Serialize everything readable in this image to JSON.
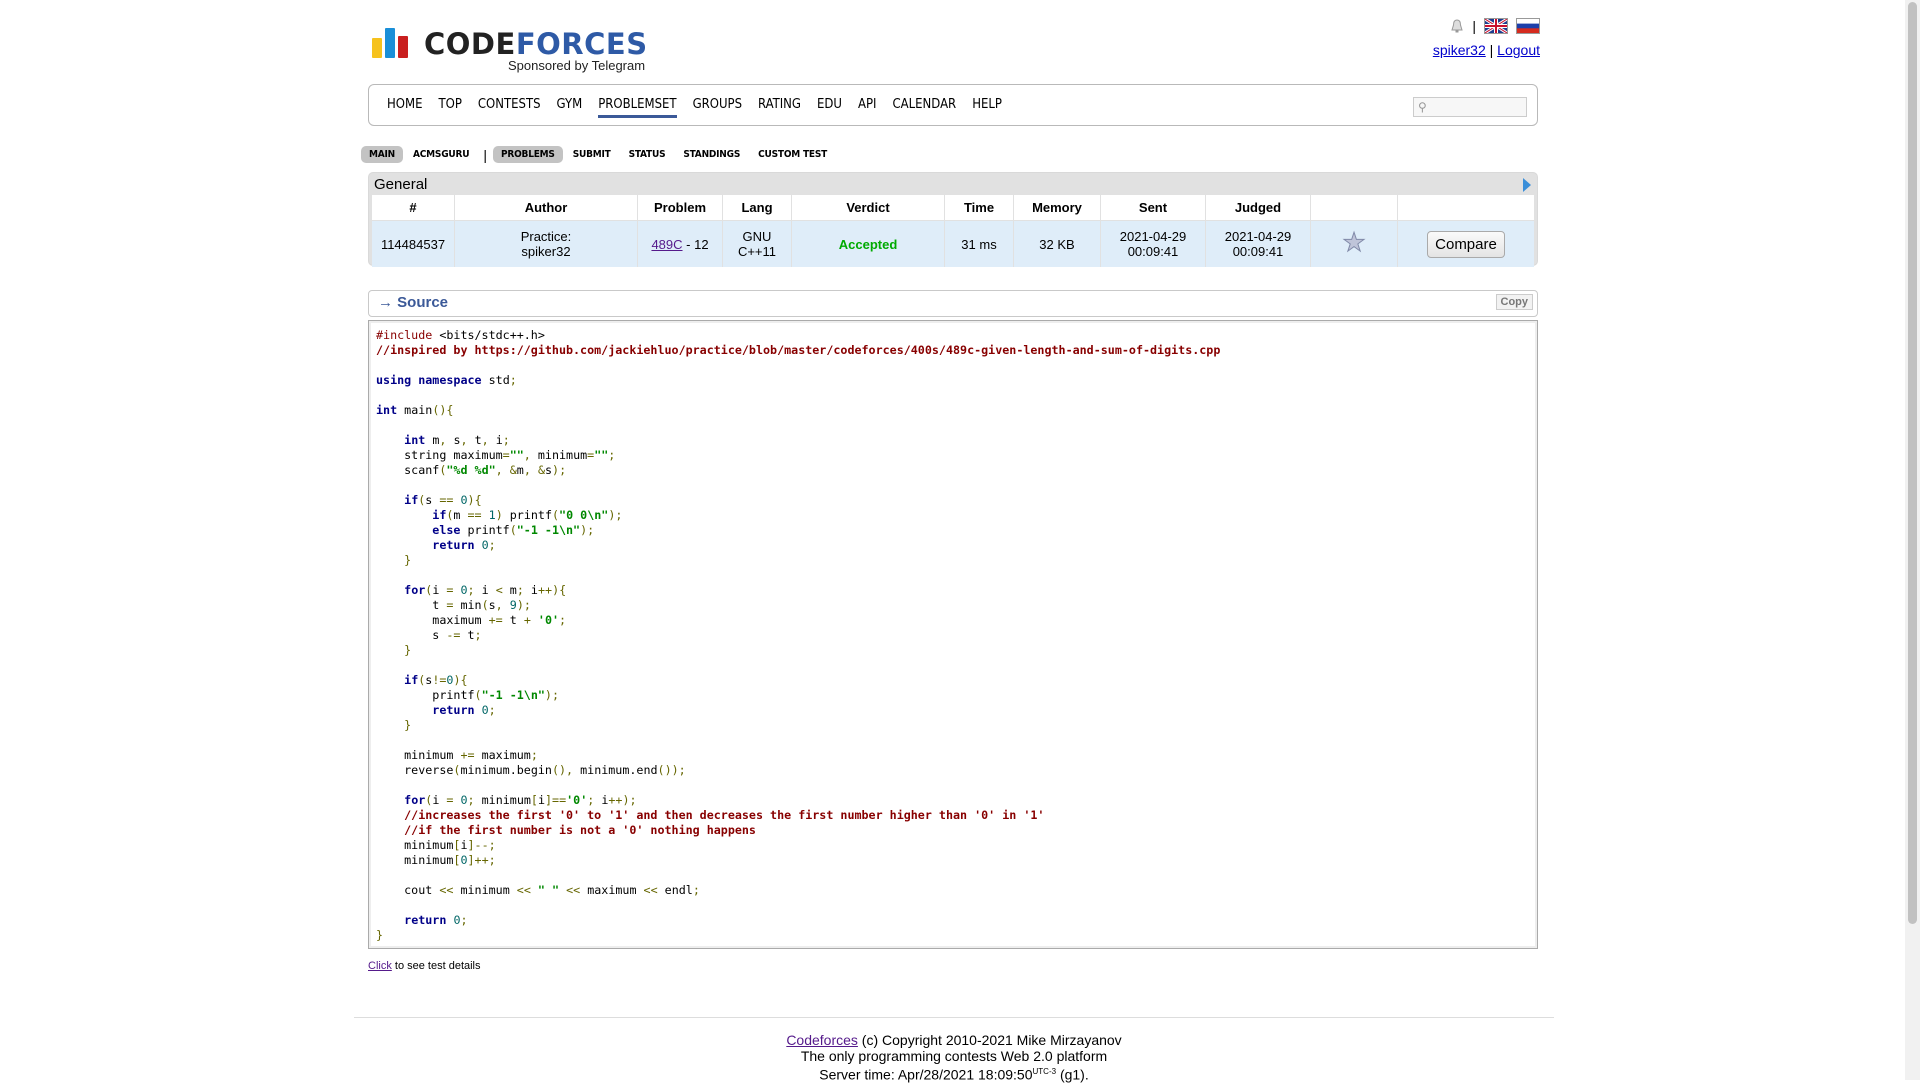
{
  "header": {
    "logo_code": "CODE",
    "logo_forces": "FORCES",
    "logo_sub": "Sponsored by Telegram",
    "user": "spiker32",
    "logout": "Logout",
    "separator": "|"
  },
  "menu": {
    "items": [
      "HOME",
      "TOP",
      "CONTESTS",
      "GYM",
      "PROBLEMSET",
      "GROUPS",
      "RATING",
      "EDU",
      "API",
      "CALENDAR",
      "HELP"
    ],
    "active": "PROBLEMSET",
    "search_placeholder": ""
  },
  "subnav": {
    "items": [
      "MAIN",
      "ACMSGURU",
      "PROBLEMS",
      "SUBMIT",
      "STATUS",
      "STANDINGS",
      "CUSTOM TEST"
    ]
  },
  "general": {
    "caption": "General",
    "columns": [
      "#",
      "Author",
      "Problem",
      "Lang",
      "Verdict",
      "Time",
      "Memory",
      "Sent",
      "Judged",
      "",
      ""
    ],
    "row": {
      "id": "114484537",
      "author_line1": "Practice:",
      "author_line2": "spiker32",
      "problem_link": "489C",
      "problem_suffix": " - 12",
      "lang_line1": "GNU",
      "lang_line2": "C++11",
      "verdict": "Accepted",
      "time": "31 ms",
      "memory": "32 KB",
      "sent_date": "2021-04-29",
      "sent_time": "00:09:41",
      "judged_date": "2021-04-29",
      "judged_time": "00:09:41",
      "compare": "Compare"
    }
  },
  "source": {
    "title": "→ Source",
    "copy": "Copy",
    "code": "#include <bits/stdc++.h>\n//inspired by https://github.com/jackiehluo/practice/blob/master/codeforces/400s/489c-given-length-and-sum-of-digits.cpp\n\nusing namespace std;\n\nint main(){\n\n    int m, s, t, i;\n    string maximum=\"\", minimum=\"\";\n    scanf(\"%d %d\", &m, &s);\n\n    if(s == 0){\n        if(m == 1) printf(\"0 0\\n\");\n        else printf(\"-1 -1\\n\");\n        return 0;\n    }\n\n    for(i = 0; i < m; i++){\n        t = min(s, 9);\n        maximum += t + '0';\n        s -= t;\n    }\n\n    if(s!=0){\n        printf(\"-1 -1\\n\");\n        return 0;\n    }\n\n    minimum += maximum;\n    reverse(minimum.begin(), minimum.end());\n\n    for(i = 0; minimum[i]=='0'; i++);\n    //increases the first '0' to '1' and then decreases the first number higher than '0' in '1'\n    //if the first number is not a '0' nothing happens\n    minimum[i]--;\n    minimum[0]++;\n\n    cout << minimum << \" \" << maximum << endl;\n\n    return 0;\n}"
  },
  "click": {
    "link": "Click",
    "rest": " to see test details"
  },
  "footer": {
    "link": "Codeforces",
    "copyright": " (c) Copyright 2010-2021 Mike Mirzayanov",
    "line2": "The only programming contests Web 2.0 platform",
    "server_prefix": "Server time: Apr/28/2021 18:09:50",
    "server_tz": "UTC-3",
    "server_suffix": " (g1)."
  },
  "colors": {
    "accent": "#3b5998",
    "accepted": "#00aa00",
    "row_bg": "#dfedf9"
  }
}
